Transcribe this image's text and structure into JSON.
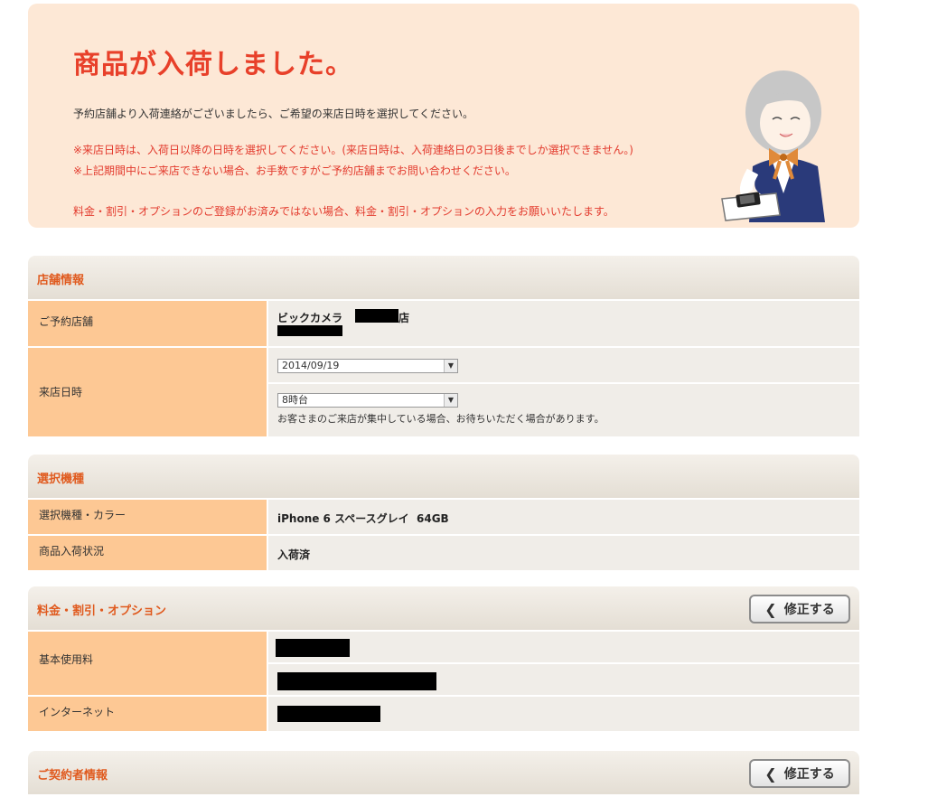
{
  "notice": {
    "title": "商品が入荷しました。",
    "intro": "予約店舗より入荷連絡がございましたら、ご希望の来店日時を選択してください。",
    "warning1": "※来店日時は、入荷日以降の日時を選択してください。(来店日時は、入荷連絡日の3日後までしか選択できません。)",
    "warning2": "※上記期間中にご来店できない場合、お手数ですがご予約店舗までお問い合わせください。",
    "warning3": "料金・割引・オプションのご登録がお済みではない場合、料金・割引・オプションの入力をお願いいたします。"
  },
  "store_info": {
    "heading": "店舗情報",
    "reserved_store_label": "ご予約店舗",
    "store_name_prefix": "ビックカメラ",
    "store_name_suffix": "店",
    "visit_datetime_label": "来店日時",
    "date_select": "2014/09/19",
    "time_select": "8時台",
    "crowd_note": "お客さまのご来店が集中している場合、お待ちいただく場合があります。"
  },
  "model": {
    "heading": "選択機種",
    "model_color_label": "選択機種・カラー",
    "model_value": "iPhone 6 スペースグレイ  64GB",
    "stock_label": "商品入荷状況",
    "stock_value": "入荷済"
  },
  "plan": {
    "heading": "料金・割引・オプション",
    "edit_label": "修正する",
    "basic_fee_label": "基本使用料",
    "internet_label": "インターネット"
  },
  "contractor": {
    "heading": "ご契約者情報",
    "edit_label": "修正する"
  },
  "colors": {
    "title_red": "#e8402a",
    "notice_bg": "#fde8d6",
    "label_bg": "#fdc894",
    "heading_orange": "#e05a1e"
  }
}
